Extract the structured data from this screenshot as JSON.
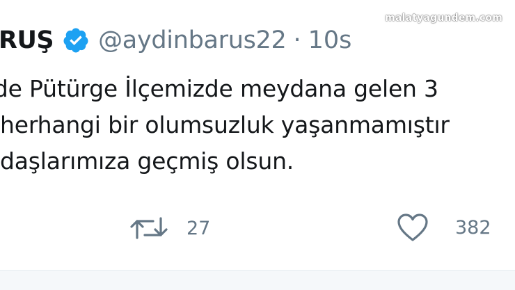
{
  "tweet": {
    "display_name": "RUŞ",
    "handle": "@aydinbarus22",
    "separator": "·",
    "time": "10s",
    "lines": [
      "'de Pütürge İlçemizde meydana gelen 3",
      "herhangi bir olumsuzluk yaşanmamıştır",
      "daşlarımıza geçmiş olsun."
    ],
    "retweet_count": "27",
    "like_count": "382"
  },
  "watermark": "malatyagundem.com",
  "colors": {
    "verified": "#1da1f2",
    "muted": "#657786",
    "text": "#14171a"
  }
}
